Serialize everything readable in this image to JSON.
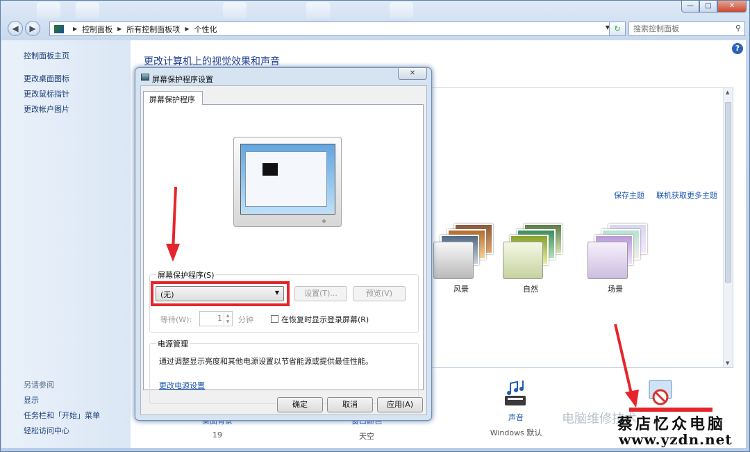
{
  "window": {
    "controls": {
      "minimize": "—",
      "maximize": "□",
      "close": "✕"
    }
  },
  "nav": {
    "back": "◀",
    "forward": "▶",
    "breadcrumb": [
      "控制面板",
      "所有控制面板项",
      "个性化"
    ],
    "search_placeholder": "搜索控制面板"
  },
  "sidebar": {
    "home": "控制面板主页",
    "links": [
      "更改桌面图标",
      "更改鼠标指针",
      "更改帐户图片"
    ],
    "see_also_title": "另请参阅",
    "see_also": [
      "显示",
      "任务栏和「开始」菜单",
      "轻松访问中心"
    ]
  },
  "main": {
    "title": "更改计算机上的视觉效果和声音",
    "help": "?",
    "save_theme": "保存主题",
    "get_more_themes": "联机获取更多主题",
    "themes": [
      "风景",
      "自然",
      "场景"
    ],
    "bottom": [
      {
        "label": "桌面背景",
        "value": "19"
      },
      {
        "label": "窗口颜色",
        "value": "天空"
      },
      {
        "label": "声音",
        "value": "Windows 默认"
      }
    ]
  },
  "dialog": {
    "title": "屏幕保护程序设置",
    "close": "✕",
    "tab": "屏幕保护程序",
    "screensaver_label": "屏幕保护程序(S)",
    "screensaver_value": "(无)",
    "settings_btn": "设置(T)...",
    "preview_btn": "预览(V)",
    "wait_label": "等待(W):",
    "wait_value": "1",
    "wait_unit": "分钟",
    "resume_label": "在恢复时显示登录屏幕(R)",
    "power_group": "电源管理",
    "power_desc": "通过调整显示亮度和其他电源设置以节省能源或提供最佳性能。",
    "power_link": "更改电源设置",
    "ok": "确定",
    "cancel": "取消",
    "apply": "应用(A)"
  },
  "watermark": {
    "brand": "电脑维修技术",
    "site_cn": "蔡店忆众电脑",
    "url": "www.yzdn.net"
  },
  "colors": {
    "highlight": "#e4262c",
    "link": "#1a57b2",
    "title": "#1e3d8f"
  }
}
